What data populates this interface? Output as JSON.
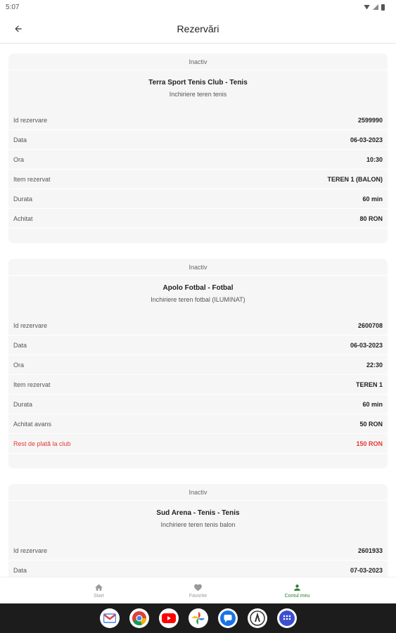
{
  "status_bar": {
    "time": "5:07"
  },
  "app_bar": {
    "title": "Rezervări"
  },
  "reservations": [
    {
      "status": "Inactiv",
      "club": "Terra Sport Tenis Club - Tenis",
      "description": "Inchiriere teren tenis",
      "rows": [
        {
          "label": "Id rezervare",
          "value": "2599990"
        },
        {
          "label": "Data",
          "value": "06-03-2023"
        },
        {
          "label": "Ora",
          "value": "10:30"
        },
        {
          "label": "Item rezervat",
          "value": "TEREN 1 (BALON)"
        },
        {
          "label": "Durata",
          "value": "60 min"
        },
        {
          "label": "Achitat",
          "value": "80 RON"
        }
      ]
    },
    {
      "status": "Inactiv",
      "club": "Apolo Fotbal - Fotbal",
      "description": "Inchiriere teren fotbal (ILUMINAT)",
      "rows": [
        {
          "label": "Id rezervare",
          "value": "2600708"
        },
        {
          "label": "Data",
          "value": "06-03-2023"
        },
        {
          "label": "Ora",
          "value": "22:30"
        },
        {
          "label": "Item rezervat",
          "value": "TEREN 1"
        },
        {
          "label": "Durata",
          "value": "60 min"
        },
        {
          "label": "Achitat avans",
          "value": "50 RON"
        },
        {
          "label": "Rest de plată la club",
          "value": "150 RON"
        }
      ]
    },
    {
      "status": "Inactiv",
      "club": "Sud Arena - Tenis - Tenis",
      "description": "Inchiriere teren tenis balon",
      "rows": [
        {
          "label": "Id rezervare",
          "value": "2601933"
        },
        {
          "label": "Data",
          "value": "07-03-2023"
        }
      ]
    }
  ],
  "bottom_nav": [
    {
      "label": "Start",
      "icon": "home-icon"
    },
    {
      "label": "Favorite",
      "icon": "heart-icon"
    },
    {
      "label": "Contul meu",
      "icon": "person-icon"
    }
  ],
  "taskbar_apps": [
    "gmail-icon",
    "chrome-icon",
    "youtube-icon",
    "photos-icon",
    "messages-icon",
    "app-icon",
    "app-drawer-icon"
  ],
  "colors": {
    "accent": "#2e7d32",
    "alert": "#e53935"
  }
}
